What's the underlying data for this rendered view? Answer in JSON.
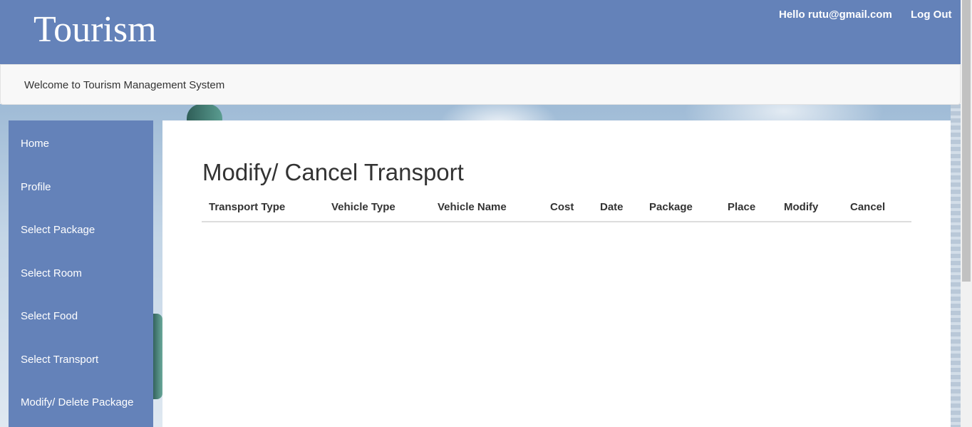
{
  "header": {
    "brand": "Tourism",
    "greeting": "Hello rutu@gmail.com",
    "logout": "Log Out"
  },
  "welcome": {
    "text": "Welcome to Tourism Management System"
  },
  "sidebar": {
    "items": [
      {
        "label": "Home"
      },
      {
        "label": "Profile"
      },
      {
        "label": "Select Package"
      },
      {
        "label": "Select Room"
      },
      {
        "label": "Select Food"
      },
      {
        "label": "Select Transport"
      },
      {
        "label": "Modify/ Delete Package"
      }
    ]
  },
  "main": {
    "title": "Modify/ Cancel Transport",
    "table": {
      "columns": [
        "Transport Type",
        "Vehicle Type",
        "Vehicle Name",
        "Cost",
        "Date",
        "Package",
        "Place",
        "Modify",
        "Cancel"
      ],
      "rows": []
    }
  },
  "colors": {
    "brand_blue": "#6482b9",
    "panel_white": "#ffffff",
    "welcome_bg": "#f8f8f8"
  }
}
